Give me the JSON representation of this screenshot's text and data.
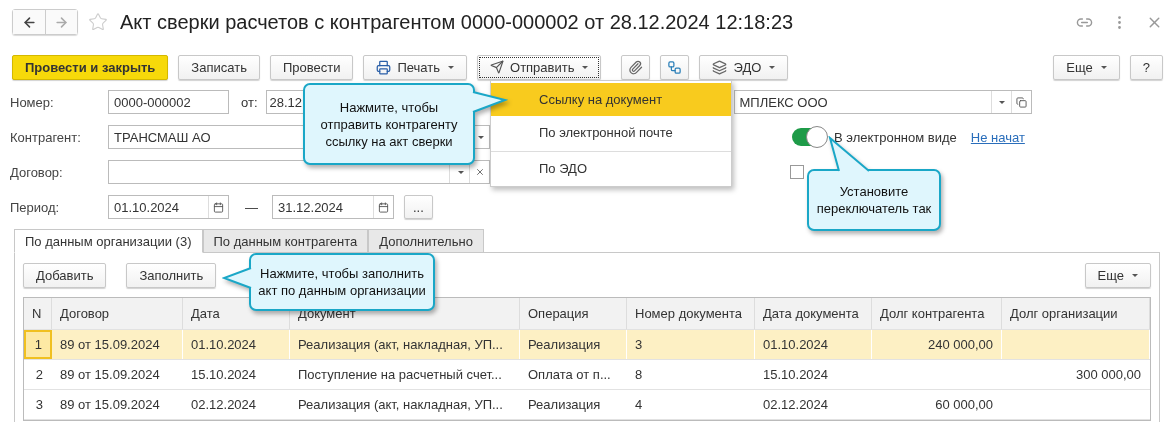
{
  "window": {
    "title": "Акт сверки расчетов с контрагентом 0000-000002 от 28.12.2024 12:18:23"
  },
  "toolbar": [
    {
      "label": "Провести и закрыть",
      "kind": "primary"
    },
    {
      "label": "Записать",
      "kind": "plain"
    },
    {
      "label": "Провести",
      "kind": "plain"
    },
    {
      "label": "Печать",
      "kind": "print"
    },
    {
      "label": "Отправить",
      "kind": "send"
    },
    {
      "kind": "attach"
    },
    {
      "kind": "structure"
    },
    {
      "label": "ЭДО",
      "kind": "edo"
    },
    {
      "label": "Еще",
      "kind": "more"
    },
    {
      "label": "?",
      "kind": "help"
    }
  ],
  "send_menu": {
    "items": [
      {
        "label": "Ссылку на документ",
        "selected": true,
        "separator_before": false
      },
      {
        "label": "По электронной почте",
        "selected": false,
        "separator_before": false
      },
      {
        "label": "По ЭДО",
        "selected": false,
        "separator_before": true
      }
    ]
  },
  "form": {
    "number": {
      "label": "Номер:",
      "value": "0000-000002"
    },
    "date": {
      "label": "от:",
      "value": "28.12"
    },
    "organization": {
      "value": "МПЛЕКС ООО"
    },
    "counterparty": {
      "label": "Контрагент:",
      "value": "ТРАНСМАШ АО"
    },
    "electronic": {
      "on": true,
      "label": "В электронном виде",
      "status": "Не начат"
    },
    "contract": {
      "label": "Договор:"
    },
    "option": {
      "checked": false
    },
    "period": {
      "label": "Период:",
      "from": "01.10.2024",
      "separator": "—",
      "to": "31.12.2024",
      "button": "..."
    }
  },
  "tabs": [
    {
      "label": "По данным организации (3)",
      "selected": true
    },
    {
      "label": "По данным контрагента",
      "selected": false
    },
    {
      "label": "Дополнительно",
      "selected": false
    }
  ],
  "table_toolbar": {
    "buttons": [
      "Добавить",
      "Заполнить"
    ],
    "more": "Еще"
  },
  "table": {
    "columns": [
      "N",
      "Договор",
      "Дата",
      "Документ",
      "Операция",
      "Номер документа",
      "Дата документа",
      "Долг контрагента",
      "Долг организации"
    ],
    "rows": [
      {
        "n": "1",
        "contract": "89 от 15.09.2024",
        "date": "01.10.2024",
        "document": "Реализация (акт, накладная, УП...",
        "operation": "Реализация",
        "doc_number": "3",
        "doc_date": "01.10.2024",
        "counterparty_debt": "240 000,00",
        "selected": true
      },
      {
        "n": "2",
        "contract": "89 от 15.09.2024",
        "date": "15.10.2024",
        "document": "Поступление на расчетный счет...",
        "operation": "Оплата от п...",
        "doc_number": "8",
        "doc_date": "15.10.2024",
        "organization_debt": "300 000,00",
        "selected": false
      },
      {
        "n": "3",
        "contract": "89 от 15.09.2024",
        "date": "02.12.2024",
        "document": "Реализация (акт, накладная, УП...",
        "operation": "Реализация",
        "doc_number": "4",
        "doc_date": "02.12.2024",
        "counterparty_debt": "60 000,00",
        "selected": false
      }
    ]
  },
  "callouts": [
    {
      "text": "Нажмите, чтобы отправить контрагенту ссылку на акт сверки"
    },
    {
      "text": "Установите переключатель так"
    },
    {
      "text": "Нажмите, чтобы заполнить акт по данным организации"
    }
  ]
}
